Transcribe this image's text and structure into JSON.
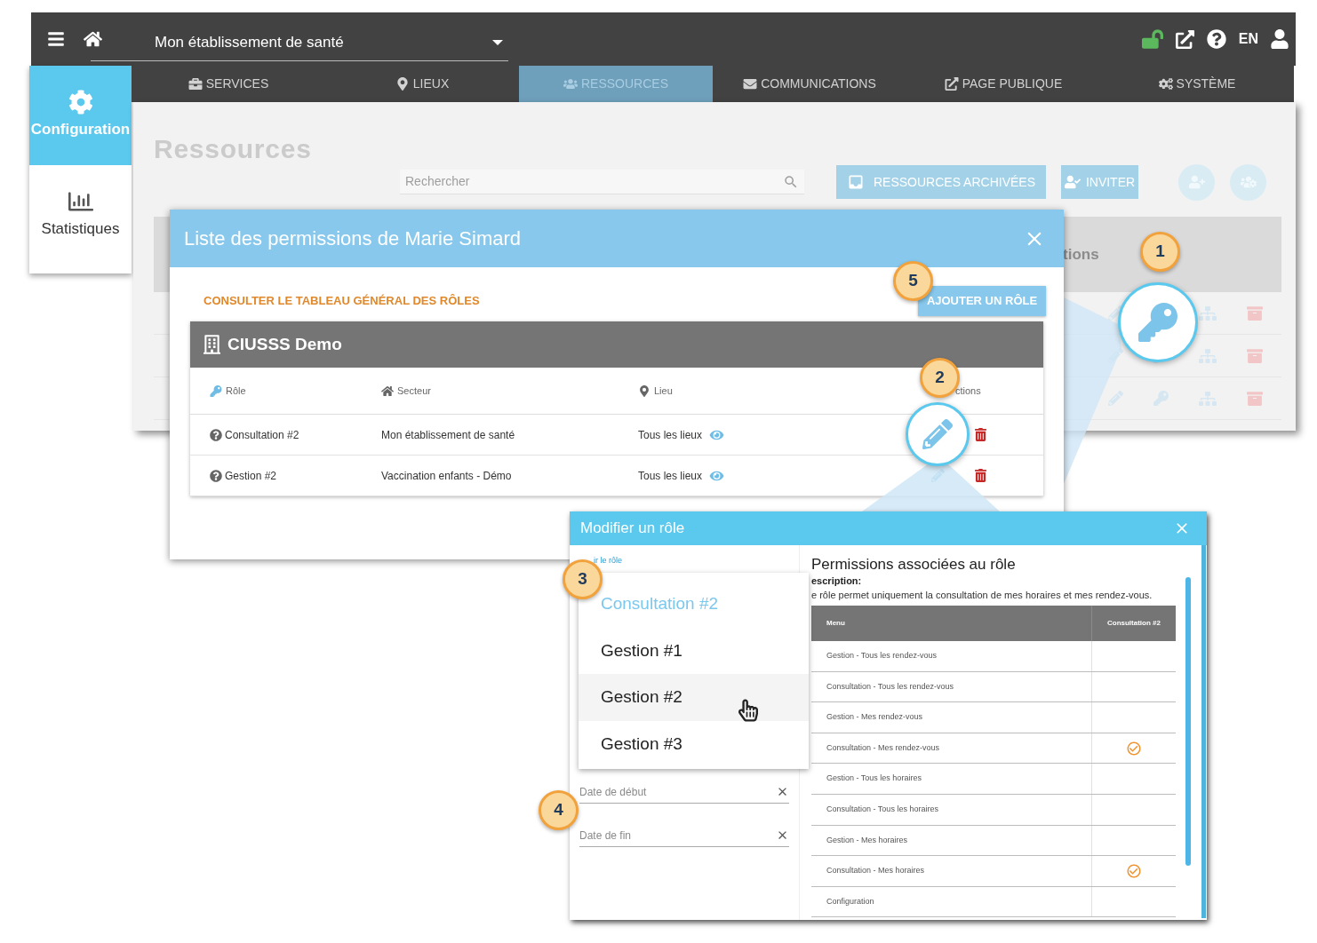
{
  "topbar": {
    "establishment": "Mon établissement de santé",
    "language": "EN"
  },
  "sidebar": {
    "items": [
      {
        "label": "Configuration",
        "selected": true
      },
      {
        "label": "Statistiques",
        "selected": false
      }
    ]
  },
  "tabs": [
    {
      "label": "SERVICES",
      "selected": false
    },
    {
      "label": "LIEUX",
      "selected": false
    },
    {
      "label": "RESSOURCES",
      "selected": true
    },
    {
      "label": "COMMUNICATIONS",
      "selected": false
    },
    {
      "label": "PAGE PUBLIQUE",
      "selected": false
    },
    {
      "label": "SYSTÈME",
      "selected": false
    }
  ],
  "page": {
    "title": "Ressources",
    "search": {
      "placeholder": "Rechercher"
    },
    "buttons": [
      "RESSOURCES ARCHIVÉES",
      "INVITER"
    ],
    "table_header": "tions"
  },
  "permissions_dialog": {
    "title": "Liste des permissions de Marie Simard",
    "link": "CONSULTER LE TABLEAU GÉNÉRAL DES RÔLES",
    "add_button": "AJOUTER UN RÔLE",
    "group": "CIUSSS Demo",
    "columns": [
      "Rôle",
      "Secteur",
      "Lieu",
      "ctions"
    ],
    "rows": [
      {
        "role": "Consultation #2",
        "sector": "Mon établissement de santé",
        "location": "Tous les lieux"
      },
      {
        "role": "Gestion #2",
        "sector": "Vaccination enfants - Démo",
        "location": "Tous les lieux"
      }
    ]
  },
  "edit_dialog": {
    "title": "Modifier un rôle",
    "role_label": "ir le rôle",
    "role_options": [
      {
        "label": "Consultation #2",
        "selected": true,
        "hovered": false
      },
      {
        "label": "Gestion #1",
        "selected": false,
        "hovered": false
      },
      {
        "label": "Gestion #2",
        "selected": false,
        "hovered": true
      },
      {
        "label": "Gestion #3",
        "selected": false,
        "hovered": false
      }
    ],
    "start_date": {
      "placeholder": "Date de début"
    },
    "end_date": {
      "placeholder": "Date de fin"
    },
    "permissions_title": "Permissions associées au rôle",
    "description_label": "escription:",
    "description": "e rôle permet uniquement la consultation de mes horaires et mes rendez-vous.",
    "table": {
      "columns": [
        "Menu",
        "Consultation #2"
      ],
      "rows": [
        {
          "menu": "Gestion - Tous les rendez-vous",
          "checked": false
        },
        {
          "menu": "Consultation - Tous les rendez-vous",
          "checked": false
        },
        {
          "menu": "Gestion - Mes rendez-vous",
          "checked": false
        },
        {
          "menu": "Consultation - Mes rendez-vous",
          "checked": true
        },
        {
          "menu": "Gestion - Tous les horaires",
          "checked": false
        },
        {
          "menu": "Consultation - Tous les horaires",
          "checked": false
        },
        {
          "menu": "Gestion - Mes horaires",
          "checked": false
        },
        {
          "menu": "Consultation - Mes horaires",
          "checked": true
        },
        {
          "menu": "Configuration",
          "checked": false
        }
      ]
    }
  },
  "callouts": [
    "1",
    "2",
    "3",
    "4",
    "5"
  ]
}
